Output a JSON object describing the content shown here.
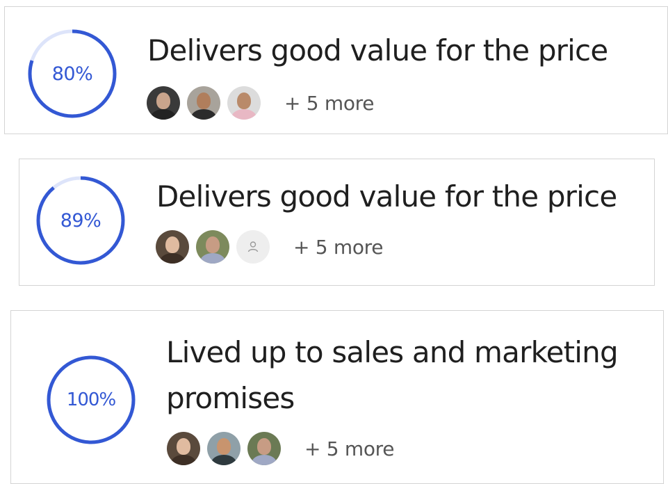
{
  "cards": [
    {
      "percent": 80,
      "percent_label": "80%",
      "title": "Delivers good value for the price",
      "more_label": "+ 5 more",
      "avatars": [
        {
          "bg": "#3a3a3a",
          "face": "#c9a48c",
          "body": "#222222"
        },
        {
          "bg": "#a8a39b",
          "face": "#b07e5c",
          "body": "#2c2c2c"
        },
        {
          "bg": "#dcdcdc",
          "face": "#b98a6a",
          "body": "#e8b8c4"
        }
      ]
    },
    {
      "percent": 89,
      "percent_label": "89%",
      "title": "Delivers good value for the price",
      "more_label": "+ 5 more",
      "avatars": [
        {
          "bg": "#5a4a3c",
          "face": "#e0bba0",
          "body": "#3d2f25"
        },
        {
          "bg": "#7d8a5c",
          "face": "#c79c84",
          "body": "#9fa8c4"
        },
        {
          "placeholder": true
        }
      ]
    },
    {
      "percent": 100,
      "percent_label": "100%",
      "title": "Lived up to sales and marketing promises",
      "more_label": "+ 5 more",
      "avatars": [
        {
          "bg": "#5a4a3c",
          "face": "#e0bba0",
          "body": "#3d2f25"
        },
        {
          "bg": "#8fa0a8",
          "face": "#c8946e",
          "body": "#2e3a3e"
        },
        {
          "bg": "#6b7a54",
          "face": "#c79c84",
          "body": "#9fa8c4"
        }
      ]
    }
  ],
  "colors": {
    "ring": "#3358d4",
    "ring_track": "#dde4fa",
    "text_primary": "#1f1f1f",
    "text_secondary": "#555555",
    "card_border": "#d4d4d4"
  }
}
